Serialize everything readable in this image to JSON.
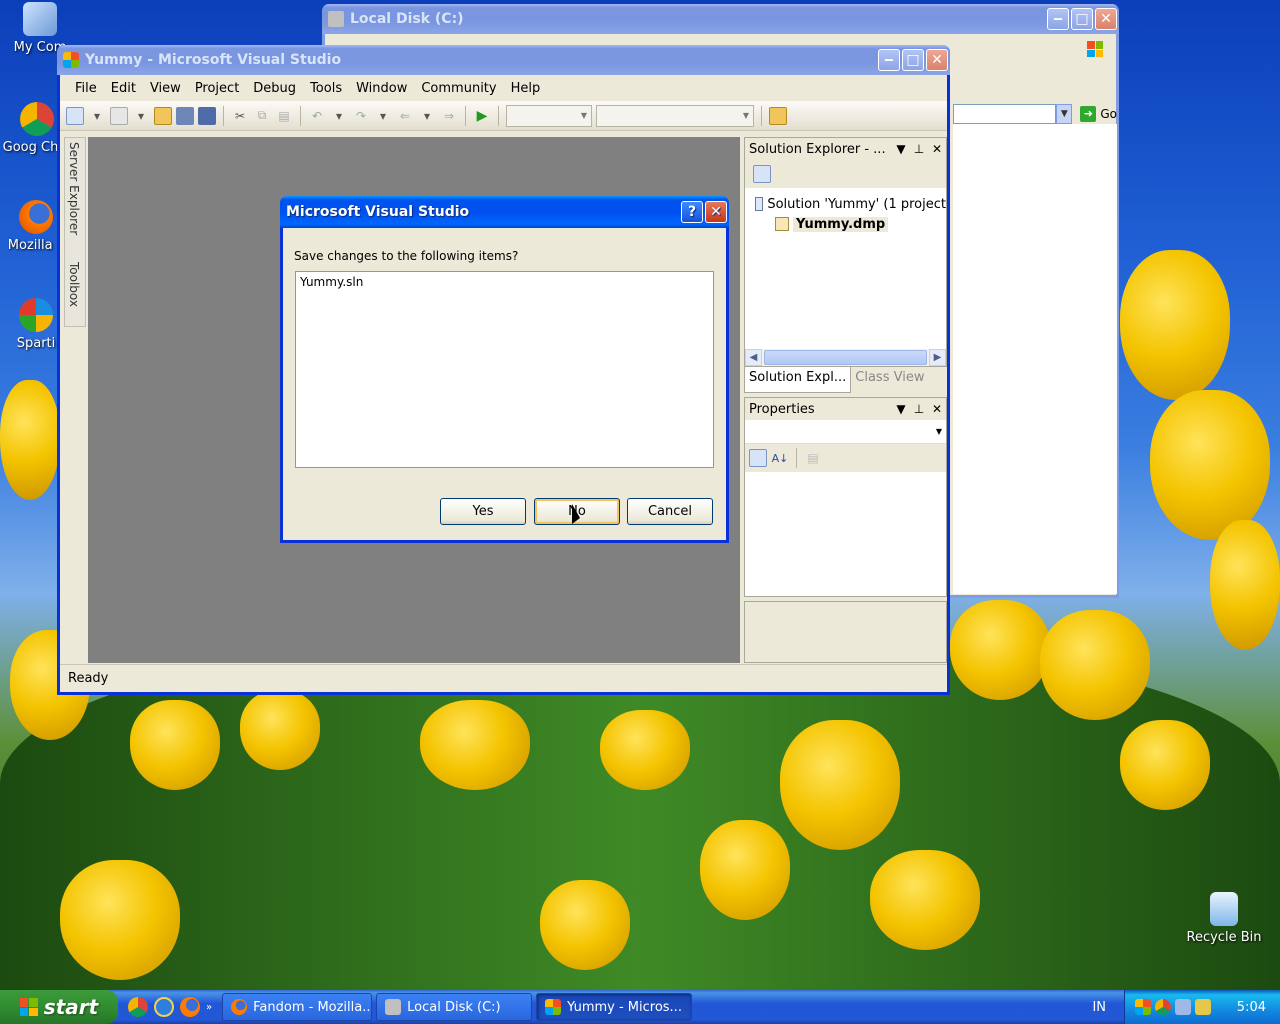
{
  "desktop": {
    "icons": [
      {
        "label": "My Com",
        "icon": "my-computer-icon"
      },
      {
        "label": "Goog Chro",
        "icon": "chrome-icon"
      },
      {
        "label": "Mozilla F",
        "icon": "firefox-icon"
      },
      {
        "label": "Sparti",
        "icon": "spartan-icon"
      },
      {
        "label": "Recycle Bin",
        "icon": "recycle-bin-icon"
      }
    ]
  },
  "local_disk_window": {
    "title": "Local Disk (C:)",
    "go_label": "Go"
  },
  "vs_window": {
    "title": "Yummy - Microsoft Visual Studio",
    "menu": [
      "File",
      "Edit",
      "View",
      "Project",
      "Debug",
      "Tools",
      "Window",
      "Community",
      "Help"
    ],
    "side_tabs": [
      "Server Explorer",
      "Toolbox"
    ],
    "solution_explorer": {
      "title": "Solution Explorer - ...",
      "tree": [
        {
          "label": "Solution 'Yummy' (1 project"
        },
        {
          "label": "Yummy.dmp"
        }
      ]
    },
    "panel_tabs": {
      "solution": "Solution Expl...",
      "class_view": "Class View"
    },
    "properties": {
      "title": "Properties"
    },
    "status": "Ready"
  },
  "dialog": {
    "title": "Microsoft Visual Studio",
    "prompt": "Save changes to the following items?",
    "items": [
      "Yummy.sln"
    ],
    "buttons": {
      "yes": "Yes",
      "no": "No",
      "cancel": "Cancel"
    }
  },
  "taskbar": {
    "start": "start",
    "tasks": [
      {
        "label": "Fandom - Mozilla...",
        "active": false
      },
      {
        "label": "Local Disk (C:)",
        "active": false
      },
      {
        "label": "Yummy - Micros...",
        "active": true
      }
    ],
    "language": "IN",
    "clock": "5:04"
  },
  "colors": {
    "title_active": "#0053ee",
    "desktop_sky": "#1f5fd4",
    "tulip": "#f4c400"
  }
}
